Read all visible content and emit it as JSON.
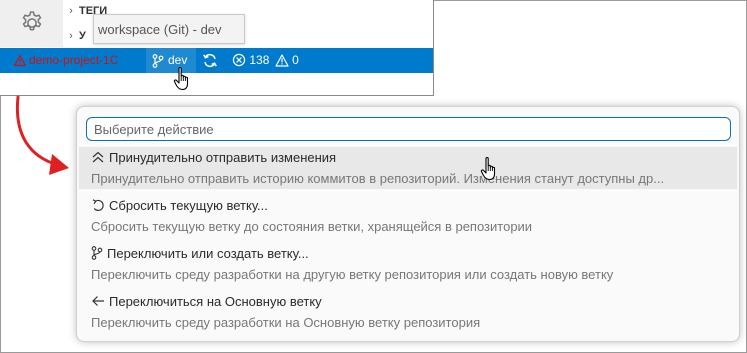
{
  "explorer": {
    "section_tags": "ТЕГИ",
    "section_second": "У"
  },
  "tooltip": {
    "text": "workspace (Git) - dev"
  },
  "status_bar": {
    "project": "demo-project-1C",
    "branch": "dev",
    "errors_count": "138",
    "warnings_count": "0"
  },
  "quick_pick": {
    "placeholder": "Выберите действие",
    "items": [
      {
        "label": "Принудительно отправить изменения",
        "detail": "Принудительно отправить историю коммитов в репозиторий. Изменения станут доступны др...",
        "icon": "double-chevron-up-icon"
      },
      {
        "label": "Сбросить текущую ветку...",
        "detail": "Сбросить текущую ветку до состояния ветки, хранящейся в репозитории",
        "icon": "undo-icon"
      },
      {
        "label": "Переключить или создать ветку...",
        "detail": "Переключить среду разработки на другую ветку репозитория или создать новую ветку",
        "icon": "git-branch-icon"
      },
      {
        "label": "Переключиться на Основную ветку",
        "detail": "Переключить среду разработки на Основную ветку репозитория",
        "icon": "arrow-left-icon"
      }
    ]
  },
  "colors": {
    "status_bar_bg": "#007acc",
    "focus_border": "#0a6fc0",
    "annotation_arrow": "#e02020",
    "error_text": "#d01010"
  }
}
